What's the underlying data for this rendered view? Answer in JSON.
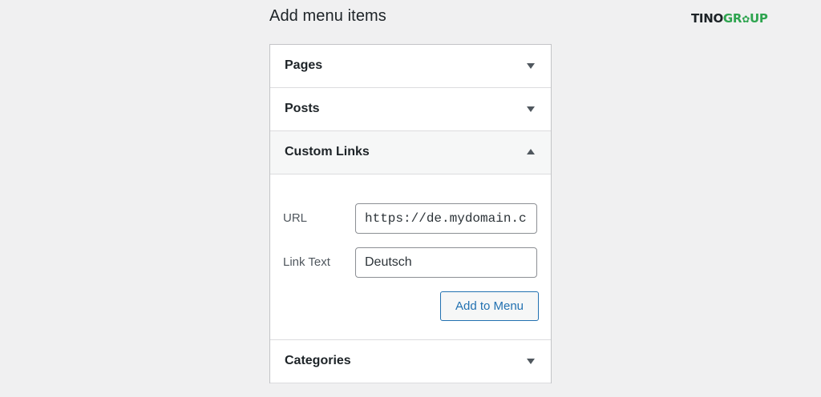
{
  "page": {
    "heading": "Add menu items"
  },
  "logo": {
    "part_a": "TINO",
    "part_b": "GR",
    "part_c": "UP",
    "ring": "✿",
    "colors": {
      "dark": "#1d2327",
      "green": "#2ea44f"
    }
  },
  "sections": [
    {
      "title": "Pages",
      "state": "collapsed",
      "toggle_icon": "chevron-down-icon"
    },
    {
      "title": "Posts",
      "state": "collapsed",
      "toggle_icon": "chevron-down-icon"
    },
    {
      "title": "Custom Links",
      "state": "expanded",
      "toggle_icon": "chevron-up-icon"
    },
    {
      "title": "Categories",
      "state": "collapsed",
      "toggle_icon": "chevron-down-icon"
    }
  ],
  "custom_links": {
    "url_label": "URL",
    "url_value": "https://de.mydomain.c",
    "link_text_label": "Link Text",
    "link_text_value": "Deutsch",
    "add_button_label": "Add to Menu"
  },
  "colors": {
    "background": "#f0f0f1",
    "panel_border": "#c3c4c7",
    "accent": "#2271b1",
    "text": "#1d2327"
  }
}
